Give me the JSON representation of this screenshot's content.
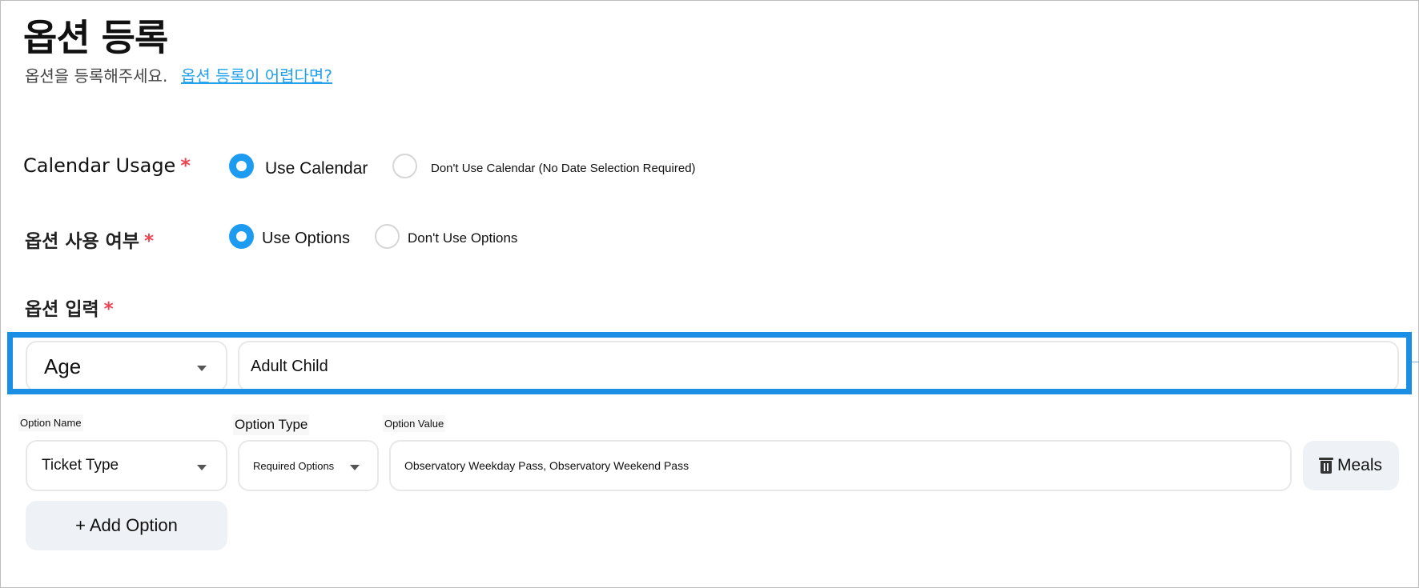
{
  "header": {
    "title": "옵션 등록",
    "subtitle": "옵션을 등록해주세요.",
    "help_link": "옵션 등록이 어렵다면?"
  },
  "calendar_usage": {
    "label": "Calendar Usage",
    "required_mark": "*",
    "options": [
      {
        "label": "Use Calendar",
        "selected": true
      },
      {
        "label": "Don't Use Calendar (No Date Selection Required)",
        "selected": false
      }
    ]
  },
  "option_usage": {
    "label": "옵션 사용 여부",
    "required_mark": "*",
    "options": [
      {
        "label": "Use Options",
        "selected": true
      },
      {
        "label": "Don't Use Options",
        "selected": false
      }
    ]
  },
  "option_input": {
    "label": "옵션 입력",
    "required_mark": "*",
    "highlighted_row": {
      "select_value": "Age",
      "text_value": "Adult Child"
    },
    "column_labels": {
      "name": "Option Name",
      "type": "Option Type",
      "value": "Option Value"
    },
    "row": {
      "name_select": "Ticket Type",
      "type_select": "Required Options",
      "value_input": "Observatory Weekday Pass, Observatory Weekend Pass",
      "delete_label": "Meals",
      "delete_icon": "trash-icon"
    },
    "add_button": "+ Add Option"
  },
  "colors": {
    "accent": "#1d9bf0",
    "highlight_border": "#1b8ee6",
    "required": "#f04452",
    "link": "#22a1ea"
  }
}
